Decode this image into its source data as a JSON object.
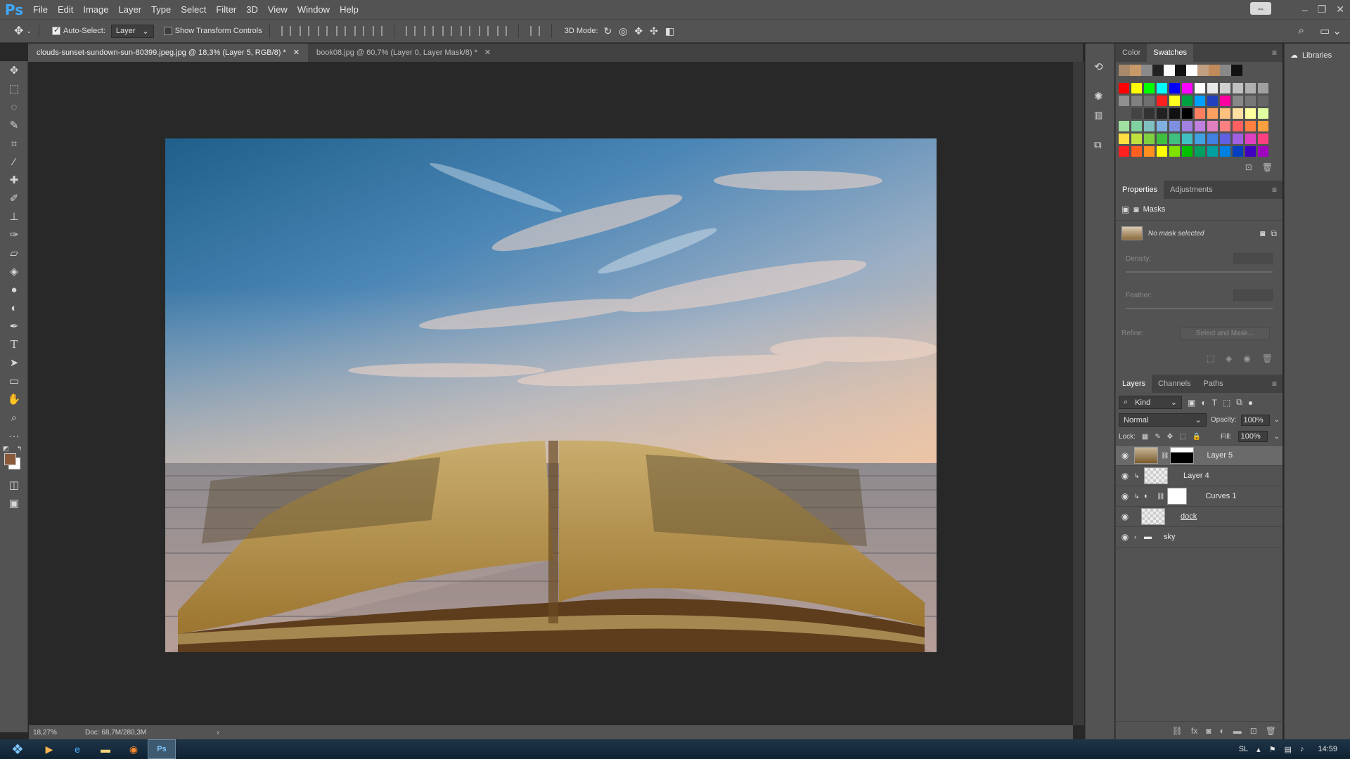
{
  "app": {
    "logo": "Ps"
  },
  "menu": [
    "File",
    "Edit",
    "Image",
    "Layer",
    "Type",
    "Select",
    "Filter",
    "3D",
    "View",
    "Window",
    "Help"
  ],
  "options": {
    "auto_select_label": "Auto-Select:",
    "auto_select_checked": true,
    "auto_select_value": "Layer",
    "show_transform_label": "Show Transform Controls",
    "show_transform_checked": false,
    "mode_3d_label": "3D Mode:"
  },
  "tabs": [
    {
      "title": "clouds-sunset-sundown-sun-80399.jpeg.jpg @ 18,3% (Layer 5, RGB/8) *",
      "active": true
    },
    {
      "title": "book08.jpg @ 60,7% (Layer 0, Layer Mask/8) *",
      "active": false
    }
  ],
  "status": {
    "zoom": "18,27%",
    "doc": "Doc: 68,7M/280,3M"
  },
  "tools": [
    "move-tool",
    "marquee-tool",
    "lasso-tool",
    "quick-select-tool",
    "crop-tool",
    "eyedropper-tool",
    "healing-brush-tool",
    "brush-tool",
    "clone-stamp-tool",
    "history-brush-tool",
    "eraser-tool",
    "paint-bucket-tool",
    "blur-tool",
    "dodge-tool",
    "pen-tool",
    "type-tool",
    "path-select-tool",
    "rectangle-tool",
    "hand-tool",
    "zoom-tool",
    "more-tools"
  ],
  "colors": {
    "foreground": "#8a5a3a",
    "background": "#ffffff"
  },
  "swatch_panel": {
    "tabs": [
      "Color",
      "Swatches"
    ],
    "active": "Swatches",
    "recent": [
      "#a88a6a",
      "#c89a6a",
      "#8a8a8a",
      "#222222",
      "#ffffff",
      "#111111",
      "#ffffff",
      "#c0a080",
      "#c08a5a",
      "#888888",
      "#111111"
    ],
    "grid": [
      "#ff0000",
      "#ffff00",
      "#00ff00",
      "#00ffff",
      "#0000ff",
      "#ff00ff",
      "#ffffff",
      "#e8e8e8",
      "#d0d0d0",
      "#c0c0c0",
      "#b0b0b0",
      "#a0a0a0",
      "#909090",
      "#808080",
      "#707070",
      "#ff2020",
      "#ffff20",
      "#00a040",
      "#00a0ff",
      "#2040c0",
      "#ff00a0",
      "#888888",
      "#777777",
      "#666666",
      "#555555",
      "#444444",
      "#333333",
      "#222222",
      "#111111",
      "#000000",
      "#ff8060",
      "#ffa060",
      "#ffc080",
      "#ffe0a0",
      "#ffffa0",
      "#e0ffa0",
      "#a0e0a0",
      "#80d0a0",
      "#80c0c0",
      "#80b0e0",
      "#8090e0",
      "#a080e0",
      "#c080e0",
      "#e080c0",
      "#ff8080",
      "#ff6060",
      "#ff8040",
      "#ffa040",
      "#ffe040",
      "#c0e040",
      "#80d040",
      "#40c040",
      "#40c080",
      "#40c0c0",
      "#40a0e0",
      "#4080e0",
      "#6060e0",
      "#a060e0",
      "#e040c0",
      "#ff4080",
      "#ff2020",
      "#ff6020",
      "#ff9020",
      "#ffff00",
      "#80e000",
      "#00c000",
      "#00a060",
      "#00a0a0",
      "#0080e0",
      "#0040c0",
      "#4000c0",
      "#a000c0"
    ]
  },
  "properties": {
    "tabs": [
      "Properties",
      "Adjustments"
    ],
    "active": "Properties",
    "section_title": "Masks",
    "no_mask": "No mask selected",
    "density_label": "Density:",
    "feather_label": "Feather:",
    "refine_label": "Refine:",
    "select_mask_btn": "Select and Mask..."
  },
  "layers_panel": {
    "tabs": [
      "Layers",
      "Channels",
      "Paths"
    ],
    "active": "Layers",
    "kind_label": "Kind",
    "blend_mode": "Normal",
    "opacity_label": "Opacity:",
    "opacity_value": "100%",
    "lock_label": "Lock:",
    "fill_label": "Fill:",
    "fill_value": "100%",
    "layers": [
      {
        "name": "Layer 5",
        "selected": true,
        "type": "image-mask"
      },
      {
        "name": "Layer 4",
        "selected": false,
        "type": "clipped"
      },
      {
        "name": "Curves 1",
        "selected": false,
        "type": "adjustment"
      },
      {
        "name": "dock",
        "selected": false,
        "type": "image"
      },
      {
        "name": "sky",
        "selected": false,
        "type": "group"
      }
    ]
  },
  "libraries": {
    "label": "Libraries"
  },
  "taskbar": {
    "lang": "SL",
    "time": "14:59"
  }
}
